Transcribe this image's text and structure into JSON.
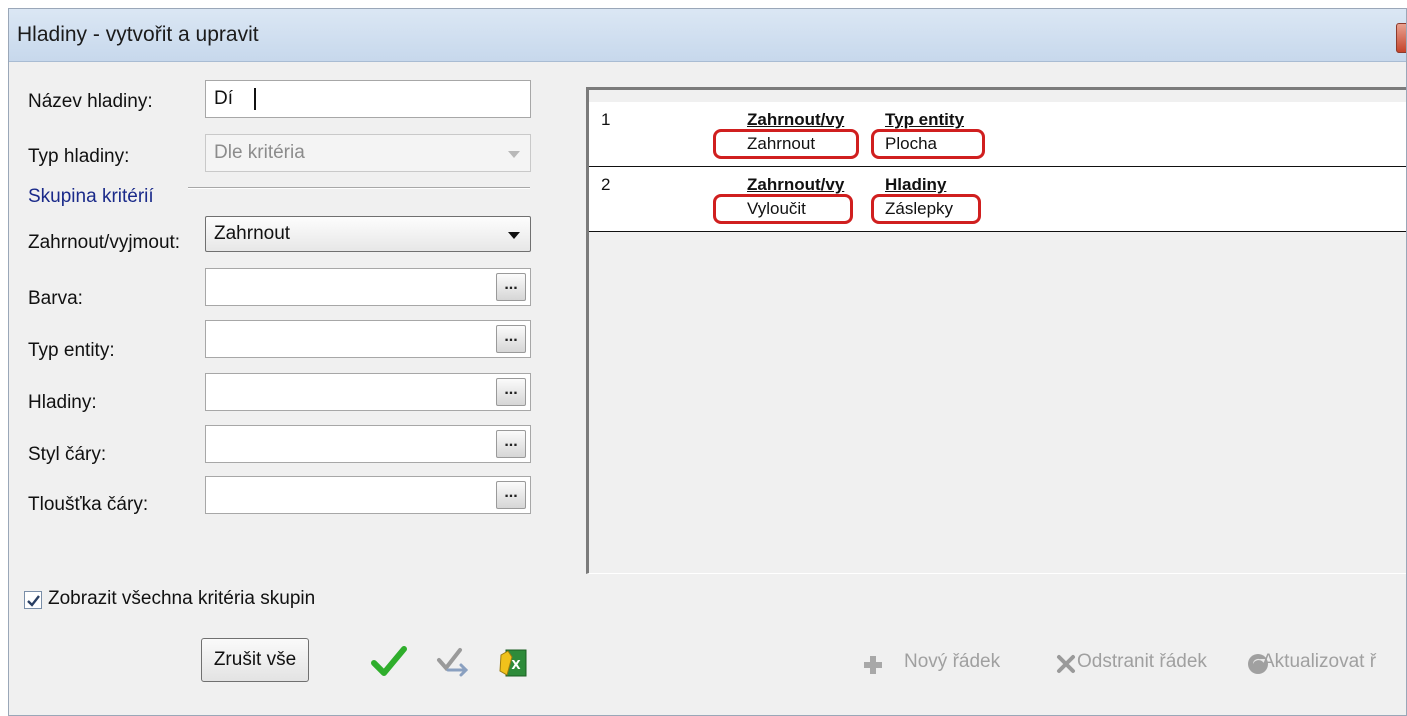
{
  "window": {
    "title": "Hladiny - vytvořit a upravit"
  },
  "form": {
    "layer_name_label": "Název hladiny:",
    "layer_name_value": "Dí",
    "layer_type_label": "Typ hladiny:",
    "layer_type_value": "Dle kritéria",
    "criteria_group_label": "Skupina kritérií",
    "include_exclude_label": "Zahrnout/vyjmout:",
    "include_exclude_value": "Zahrnout",
    "color_label": "Barva:",
    "entity_type_label": "Typ entity:",
    "layers_label": "Hladiny:",
    "line_style_label": "Styl čáry:",
    "line_weight_label": "Tloušťka čáry:",
    "ellipsis": "...",
    "show_all_label": "Zobrazit všechna kritéria skupin",
    "show_all_checked": true
  },
  "grid": {
    "rows": [
      {
        "num": "1",
        "col1_header": "Zahrnout/vy",
        "col2_header": "Typ entity",
        "col1_value": "Zahrnout",
        "col2_value": "Plocha"
      },
      {
        "num": "2",
        "col1_header": "Zahrnout/vy",
        "col2_header": "Hladiny",
        "col1_value": "Vyloučit",
        "col2_value": "Záslepky"
      }
    ]
  },
  "buttons": {
    "clear_all": "Zrušit vše"
  },
  "toolbar": {
    "new_row": "Nový řádek",
    "delete_row": "Odstranit řádek",
    "update_row": "Aktualizovat ř"
  },
  "colors": {
    "highlight": "#d01f1f",
    "title_bg": "#c7d8ec",
    "group_label": "#1a2a8a"
  },
  "icons": [
    "close-icon",
    "dropdown-arrow-icon",
    "checkmark-icon",
    "transfer-icon",
    "excel-export-icon",
    "plus-icon",
    "delete-x-icon",
    "refresh-icon"
  ]
}
